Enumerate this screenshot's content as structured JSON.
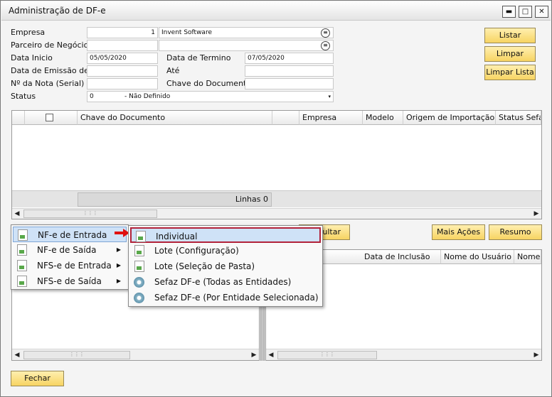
{
  "window": {
    "title": "Administração de DF-e",
    "minimize": "▬",
    "maximize": "□",
    "close": "✕"
  },
  "form": {
    "empresa_label": "Empresa",
    "empresa_code": "1",
    "empresa_name": "Invent Software",
    "parceiro_label": "Parceiro de Negócios",
    "data_inicio_label": "Data Inicio",
    "data_inicio": "05/05/2020",
    "data_termino_label": "Data de Termino",
    "data_termino": "07/05/2020",
    "data_emissao_label": "Data de Emissão de",
    "ate_label": "Até",
    "nota_label": "Nº da Nota (Serial)",
    "chave_label": "Chave do Documento",
    "status_label": "Status",
    "status_code": "0",
    "status_value": "- Não Definido"
  },
  "buttons": {
    "listar": "Listar",
    "limpar_filtros": "Limpar Filtros",
    "limpar_lista": "Limpar Lista",
    "consultar_partial": "sultar",
    "mais_acoes": "Mais Ações",
    "resumo": "Resumo",
    "fechar": "Fechar"
  },
  "grid1": {
    "columns": [
      "Chave do Documento",
      "Empresa",
      "Modelo",
      "Origem de Importação",
      "Status Sefaz"
    ],
    "footer": "Linhas 0"
  },
  "grid2": {
    "columns": [
      "Data de Inclusão",
      "Nome do Usuário",
      "Nome do"
    ]
  },
  "menu1": {
    "items": [
      "NF-e de Entrada",
      "NF-e de Saída",
      "NFS-e de Entrada",
      "NFS-e de Saída"
    ]
  },
  "menu2": {
    "items": [
      "Individual",
      "Lote (Configuração)",
      "Lote (Seleção de Pasta)",
      "Sefaz DF-e (Todas as Entidades)",
      "Sefaz DF-e (Por Entidade Selecionada)"
    ]
  },
  "colors": {
    "button_bg": "#f7d462",
    "highlight": "#cfe2f7",
    "arrow": "#e01010"
  }
}
